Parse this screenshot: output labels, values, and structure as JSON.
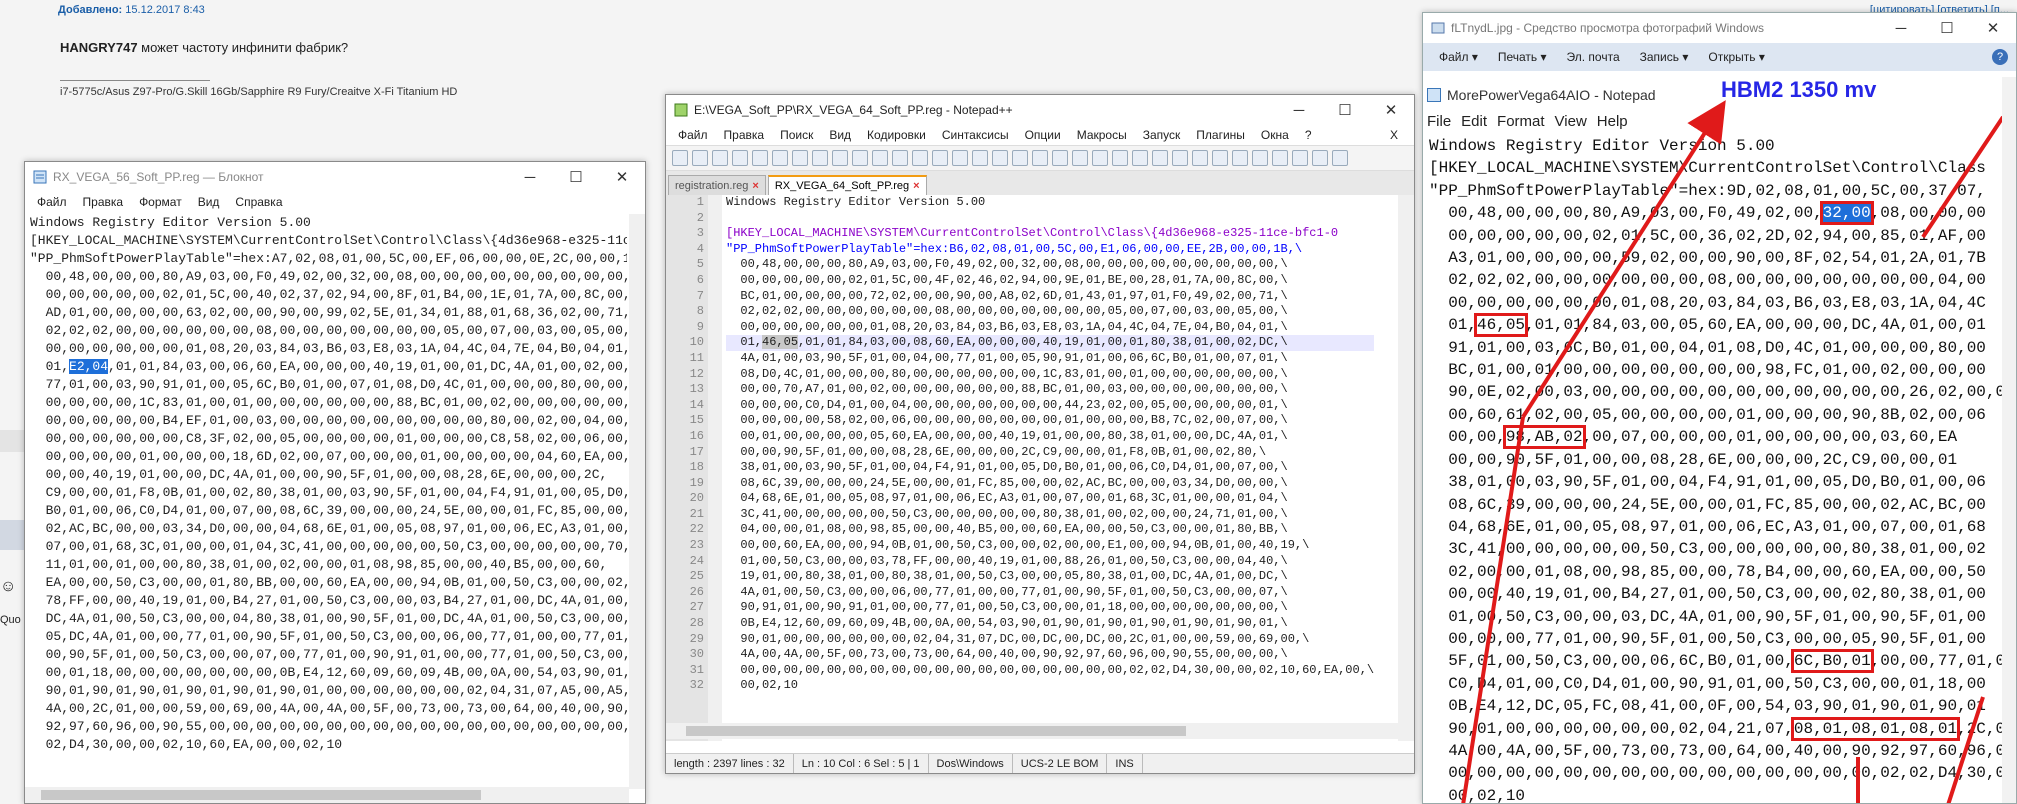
{
  "forum": {
    "added_label": "Добавлено:",
    "added_date": "15.12.2017 8:43",
    "right_links": "[цитировать] [ответить] [п...",
    "post_author": "HANGRY747",
    "post_text": " может частоту инфинити фабрик?",
    "signature": "i7-5775c/Asus Z97-Pro/G.Skill 16Gb/Sapphire R9 Fury/Creaitve X-Fi Titanium HD",
    "quote_label": "Quo"
  },
  "notepad1": {
    "title": "RX_VEGA_56_Soft_PP.reg — Блокнот",
    "menu": [
      "Файл",
      "Правка",
      "Формат",
      "Вид",
      "Справка"
    ],
    "lines": [
      "Windows Registry Editor Version 5.00",
      "",
      "[HKEY_LOCAL_MACHINE\\SYSTEM\\CurrentControlSet\\Control\\Class\\{4d36e968-e325-11c",
      "\"PP_PhmSoftPowerPlayTable\"=hex:A7,02,08,01,00,5C,00,EF,06,00,00,0E,2C,00,00,1",
      "  00,48,00,00,00,80,A9,03,00,F0,49,02,00,32,00,08,00,00,00,00,00,00,00,00,00,",
      "  00,00,00,00,00,02,01,5C,00,40,02,37,02,94,00,8F,01,B4,00,1E,01,7A,00,8C,00,",
      "  AD,01,00,00,00,00,63,02,00,00,90,00,99,02,5E,01,34,01,88,01,68,36,02,00,71,",
      "  02,02,02,00,00,00,00,00,00,08,00,00,00,00,00,00,00,05,00,07,00,03,00,05,00,",
      "  00,00,00,00,00,00,01,08,20,03,84,03,B6,03,E8,03,1A,04,4C,04,7E,04,B0,04,01,",
      "  01,|E2,04|,01,01,84,03,00,06,60,EA,00,00,00,40,19,01,00,01,DC,4A,01,00,02,00,",
      "  77,01,00,03,90,91,01,00,05,6C,B0,01,00,07,01,08,D0,4C,01,00,00,00,80,00,00,",
      "  00,00,00,00,1C,83,01,00,01,00,00,00,00,00,00,88,BC,01,00,02,00,00,00,00,00,",
      "  00,00,00,00,00,B4,EF,01,00,03,00,00,00,00,00,00,00,00,00,80,00,02,00,04,00,",
      "  00,00,00,00,00,00,C8,3F,02,00,05,00,00,00,00,01,00,00,00,C8,58,02,00,06,00,",
      "  00,00,00,00,01,00,00,00,18,6D,02,00,07,00,00,00,01,00,00,00,00,04,60,EA,00,",
      "  00,00,40,19,01,00,00,DC,4A,01,00,00,90,5F,01,00,00,08,28,6E,00,00,00,2C,",
      "  C9,00,00,01,F8,0B,01,00,02,80,38,01,00,03,90,5F,01,00,04,F4,91,01,00,05,D0,",
      "  B0,01,00,06,C0,D4,01,00,07,00,08,6C,39,00,00,00,24,5E,00,00,01,FC,85,00,00,",
      "  02,AC,BC,00,00,03,34,D0,00,00,04,68,6E,01,00,05,08,97,01,00,06,EC,A3,01,00,",
      "  07,00,01,68,3C,01,00,00,01,04,3C,41,00,00,00,00,00,50,C3,00,00,00,00,00,70,",
      "  11,01,00,01,00,00,80,38,01,00,02,00,00,01,08,98,85,00,00,40,B5,00,00,60,",
      "  EA,00,00,50,C3,00,00,01,80,BB,00,00,60,EA,00,00,94,0B,01,00,50,C3,00,00,02,",
      "  78,FF,00,00,40,19,01,00,B4,27,01,00,50,C3,00,00,03,B4,27,01,00,DC,4A,01,00,",
      "  DC,4A,01,00,50,C3,00,00,04,80,38,01,00,90,5F,01,00,DC,4A,01,00,50,C3,00,00,",
      "  05,DC,4A,01,00,00,77,01,00,90,5F,01,00,50,C3,00,00,06,00,77,01,00,00,77,01,",
      "  00,90,5F,01,00,50,C3,00,00,07,00,77,01,00,90,91,01,00,00,77,01,00,50,C3,00,",
      "  00,01,18,00,00,00,00,00,00,00,0B,E4,12,60,09,60,09,4B,00,0A,00,54,03,90,01,",
      "  90,01,90,01,90,01,90,01,90,01,90,01,00,00,00,00,00,00,02,04,31,07,A5,00,A5,00,",
      "  4A,00,2C,01,00,00,59,00,69,00,4A,00,4A,00,5F,00,73,00,73,00,64,00,40,00,90,",
      "  92,97,60,96,00,90,55,00,00,00,00,00,00,00,00,00,00,00,00,00,00,00,00,00,00,",
      "  02,D4,30,00,00,02,10,60,EA,00,00,02,10"
    ]
  },
  "npp": {
    "title": "E:\\VEGA_Soft_PP\\RX_VEGA_64_Soft_PP.reg - Notepad++",
    "menu": [
      "Файл",
      "Правка",
      "Поиск",
      "Вид",
      "Кодировки",
      "Синтаксисы",
      "Опции",
      "Макросы",
      "Запуск",
      "Плагины",
      "Окна",
      "?"
    ],
    "close_x": "X",
    "tab1": "registration.reg",
    "tab2": "RX_VEGA_64_Soft_PP.reg",
    "line_numbers": [
      "1",
      "2",
      "3",
      "4",
      "5",
      "6",
      "7",
      "8",
      "9",
      "10",
      "11",
      "12",
      "13",
      "14",
      "15",
      "16",
      "17",
      "18",
      "19",
      "20",
      "21",
      "22",
      "23",
      "24",
      "25",
      "26",
      "27",
      "28",
      "29",
      "30",
      "31",
      "32"
    ],
    "lines": [
      "Windows Registry Editor Version 5.00",
      "",
      "[HKEY_LOCAL_MACHINE\\SYSTEM\\CurrentControlSet\\Control\\Class\\{4d36e968-e325-11ce-bfc1-0",
      "\"PP_PhmSoftPowerPlayTable\"=hex:B6,02,08,01,00,5C,00,E1,06,00,00,EE,2B,00,00,1B,\\",
      "  00,48,00,00,00,80,A9,03,00,F0,49,02,00,32,00,08,00,00,00,00,00,00,00,00,00,\\",
      "  00,00,00,00,00,02,01,5C,00,4F,02,46,02,94,00,9E,01,BE,00,28,01,7A,00,8C,00,\\",
      "  BC,01,00,00,00,00,72,02,00,00,90,00,A8,02,6D,01,43,01,97,01,F0,49,02,00,71,\\",
      "  02,02,02,00,00,00,00,00,00,08,00,00,00,00,00,00,00,05,00,07,00,03,00,05,00,\\",
      "  00,00,00,00,00,00,01,08,20,03,84,03,B6,03,E8,03,1A,04,4C,04,7E,04,B0,04,01,\\",
      "  01,46,05,01,01,84,03,00,08,60,EA,00,00,00,40,19,01,00,01,80,38,01,00,02,DC,\\",
      "  4A,01,00,03,90,5F,01,00,04,00,77,01,00,05,90,91,01,00,06,6C,B0,01,00,07,01,\\",
      "  08,D0,4C,01,00,00,00,80,00,00,00,00,00,00,1C,83,01,00,01,00,00,00,00,00,00,\\",
      "  00,00,70,A7,01,00,02,00,00,00,00,00,00,88,BC,01,00,03,00,00,00,00,00,00,00,\\",
      "  00,00,00,C0,D4,01,00,04,00,00,00,00,00,00,00,44,23,02,00,05,00,00,00,00,01,\\",
      "  00,00,00,00,58,02,00,06,00,00,00,00,00,00,00,01,00,00,00,B8,7C,02,00,07,00,\\",
      "  00,01,00,00,00,00,05,60,EA,00,00,00,40,19,01,00,00,80,38,01,00,00,DC,4A,01,\\",
      "  00,00,90,5F,01,00,00,08,28,6E,00,00,00,2C,C9,00,00,01,F8,0B,01,00,02,80,\\",
      "  38,01,00,03,90,5F,01,00,04,F4,91,01,00,05,D0,B0,01,00,06,C0,D4,01,00,07,00,\\",
      "  08,6C,39,00,00,00,24,5E,00,00,01,FC,85,00,00,02,AC,BC,00,00,03,34,D0,00,00,\\",
      "  04,68,6E,01,00,05,08,97,01,00,06,EC,A3,01,00,07,00,01,68,3C,01,00,00,01,04,\\",
      "  3C,41,00,00,00,00,00,50,C3,00,00,00,00,00,80,38,01,00,02,00,00,24,71,01,00,\\",
      "  04,00,00,01,08,00,98,85,00,00,40,B5,00,00,60,EA,00,00,50,C3,00,00,01,80,BB,\\",
      "  00,00,60,EA,00,00,94,0B,01,00,50,C3,00,00,02,00,00,E1,00,00,94,0B,01,00,40,19,\\",
      "  01,00,50,C3,00,00,03,78,FF,00,00,40,19,01,00,88,26,01,00,50,C3,00,00,04,40,\\",
      "  19,01,00,80,38,01,00,80,38,01,00,50,C3,00,00,05,80,38,01,00,DC,4A,01,00,DC,\\",
      "  4A,01,00,50,C3,00,00,06,00,77,01,00,00,77,01,00,90,5F,01,00,50,C3,00,00,07,\\",
      "  90,91,01,00,90,91,01,00,00,77,01,00,50,C3,00,00,01,18,00,00,00,00,00,00,00,\\",
      "  0B,E4,12,60,09,60,09,4B,00,0A,00,54,03,90,01,90,01,90,01,90,01,90,01,90,01,\\",
      "  90,01,00,00,00,00,00,00,02,04,31,07,DC,00,DC,00,DC,00,2C,01,00,00,59,00,69,00,\\",
      "  4A,00,4A,00,5F,00,73,00,73,00,64,00,40,00,90,92,97,60,96,00,90,55,00,00,00,\\",
      "  00,00,00,00,00,00,00,00,00,00,00,00,00,00,00,00,00,00,02,02,D4,30,00,00,02,10,60,EA,00,\\",
      "  00,02,10"
    ],
    "status": [
      "length : 2397    lines : 32",
      "Ln : 10    Col : 6    Sel : 5 | 1",
      "Dos\\Windows",
      "UCS-2 LE BOM",
      "INS"
    ]
  },
  "photo": {
    "title": "fLTnydL.jpg - Средство просмотра фотографий Windows",
    "menu": [
      "Файл ▾",
      "Печать ▾",
      "Эл. почта",
      "Запись ▾",
      "Открыть ▾"
    ],
    "help": "?",
    "img_title": "MorePowerVega64AIO - Notepad",
    "img_menu": [
      "File",
      "Edit",
      "Format",
      "View",
      "Help"
    ],
    "annotation": "HBM2 1350 mv",
    "lines": [
      "Windows Registry Editor Version 5.00",
      "",
      "[HKEY_LOCAL_MACHINE\\SYSTEM\\CurrentControlSet\\Control\\Class",
      "\"PP_PhmSoftPowerPlayTable\"=hex:9D,02,08,01,00,5C,00,37,07,",
      "  00,48,00,00,00,80,A9,03,00,F0,49,02,00,[[32,00]],08,00,00,00",
      "  00,00,00,00,00,02,01,5C,00,36,02,2D,02,94,00,85,01,AF,00",
      "  A3,01,00,00,00,00,59,02,00,00,90,00,8F,02,54,01,2A,01,7B",
      "  02,02,02,00,00,00,00,00,00,08,00,00,00,00,00,00,00,04,00",
      "  00,00,00,00,00,00,01,08,20,03,84,03,B6,03,E8,03,1A,04,4C",
      "  01,[46,05],01,01,84,03,00,05,60,EA,00,00,00,DC,4A,01,00,01",
      "  91,01,00,03,6C,B0,01,00,04,01,08,D0,4C,01,00,00,00,80,00",
      "  BC,01,00,01,00,00,00,00,00,00,00,98,FC,01,00,02,00,00,00",
      "  90,0E,02,00,03,00,00,00,00,00,00,00,00,00,00,00,26,02,00,04,00",
      "  00,60,61,02,00,05,00,00,00,00,01,00,00,00,90,8B,02,00,06",
      "  00,00,[98,AB,02],00,07,00,00,00,01,00,00,00,00,03,60,EA",
      "  00,00,90,5F,01,00,00,08,28,6E,00,00,00,2C,C9,00,00,01",
      "  38,01,00,03,90,5F,01,00,04,F4,91,01,00,05,D0,B0,01,00,06",
      "  08,6C,39,00,00,00,24,5E,00,00,01,FC,85,00,00,02,AC,BC,00",
      "  04,68,6E,01,00,05,08,97,01,00,06,EC,A3,01,00,07,00,01,68",
      "  3C,41,00,00,00,00,00,50,C3,00,00,00,00,00,80,38,01,00,02",
      "  02,00,00,01,08,00,98,85,00,00,78,B4,00,00,60,EA,00,00,50",
      "  00,00,40,19,01,00,B4,27,01,00,50,C3,00,00,02,80,38,01,00",
      "  01,00,50,C3,00,00,03,DC,4A,01,00,90,5F,01,00,90,5F,01,00",
      "  00,00,00,77,01,00,90,5F,01,00,50,C3,00,00,05,90,5F,01,00",
      "  5F,01,00,50,C3,00,00,06,6C,B0,01,00,[6C,B0,01],00,00,77,01,00",
      "  C0,D4,01,00,C0,D4,01,00,90,91,01,00,50,C3,00,00,01,18,00",
      "  0B,E4,12,DC,05,FC,08,41,00,0F,00,54,03,90,01,90,01,90,01",
      "  90,01,00,00,00,00,00,00,02,04,21,07,[08,01,08,01,08,01],2C,01",
      "  4A,00,4A,00,5F,00,73,00,73,00,64,00,40,00,90,92,97,60,96,00",
      "  00,00,00,00,00,00,00,00,00,00,00,00,00,00,00,02,02,D4,30,00",
      "  00,02,10"
    ]
  }
}
